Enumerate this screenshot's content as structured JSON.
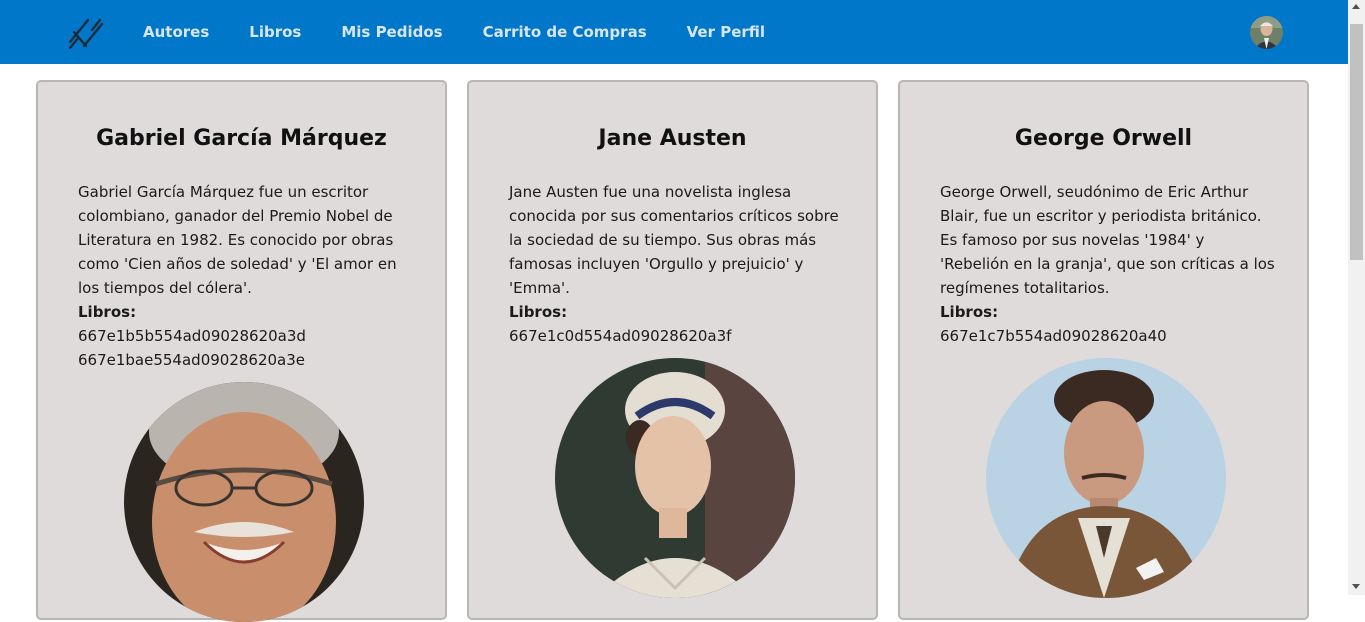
{
  "nav": {
    "links": [
      "Autores",
      "Libros",
      "Mis Pedidos",
      "Carrito de Compras",
      "Ver Perfil"
    ]
  },
  "colors": {
    "navbar": "#0077c8",
    "card": "#dfdbdb"
  },
  "authors": [
    {
      "name": "Gabriel García Márquez",
      "bio": "Gabriel García Márquez fue un escritor colombiano, ganador del Premio Nobel de Literatura en 1982. Es conocido por obras como 'Cien años de soledad' y 'El amor en los tiempos del cólera'.",
      "books_label": "Libros:",
      "books": [
        "667e1b5b554ad09028620a3d",
        "667e1bae554ad09028620a3e"
      ]
    },
    {
      "name": "Jane Austen",
      "bio": "Jane Austen fue una novelista inglesa conocida por sus comentarios críticos sobre la sociedad de su tiempo. Sus obras más famosas incluyen 'Orgullo y prejuicio' y 'Emma'.",
      "books_label": "Libros:",
      "books": [
        "667e1c0d554ad09028620a3f"
      ]
    },
    {
      "name": "George Orwell",
      "bio": "George Orwell, seudónimo de Eric Arthur Blair, fue un escritor y periodista británico. Es famoso por sus novelas '1984' y 'Rebelión en la granja', que son críticas a los regímenes totalitarios.",
      "books_label": "Libros:",
      "books": [
        "667e1c7b554ad09028620a40"
      ]
    }
  ]
}
